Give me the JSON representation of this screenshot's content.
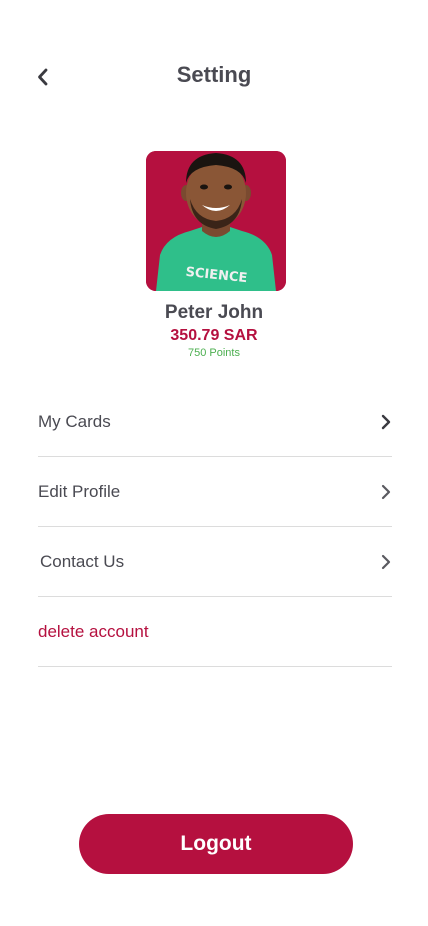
{
  "header": {
    "title": "Setting",
    "back_icon": "chevron-left-icon"
  },
  "profile": {
    "avatar": "user-photo",
    "name": "Peter John",
    "balance": "350.79 SAR",
    "points": "750 Points"
  },
  "menu": {
    "items": [
      {
        "label": "My Cards",
        "icon": "chevron-right-icon"
      },
      {
        "label": "Edit Profile",
        "icon": "chevron-right-icon"
      },
      {
        "label": "Contact Us",
        "icon": "chevron-right-icon"
      },
      {
        "label": "delete account"
      }
    ]
  },
  "footer": {
    "logout_label": "Logout"
  },
  "colors": {
    "primary": "#b5103f",
    "text": "#4a4a52",
    "points": "#4caf50",
    "divider": "#dcdcdc"
  }
}
